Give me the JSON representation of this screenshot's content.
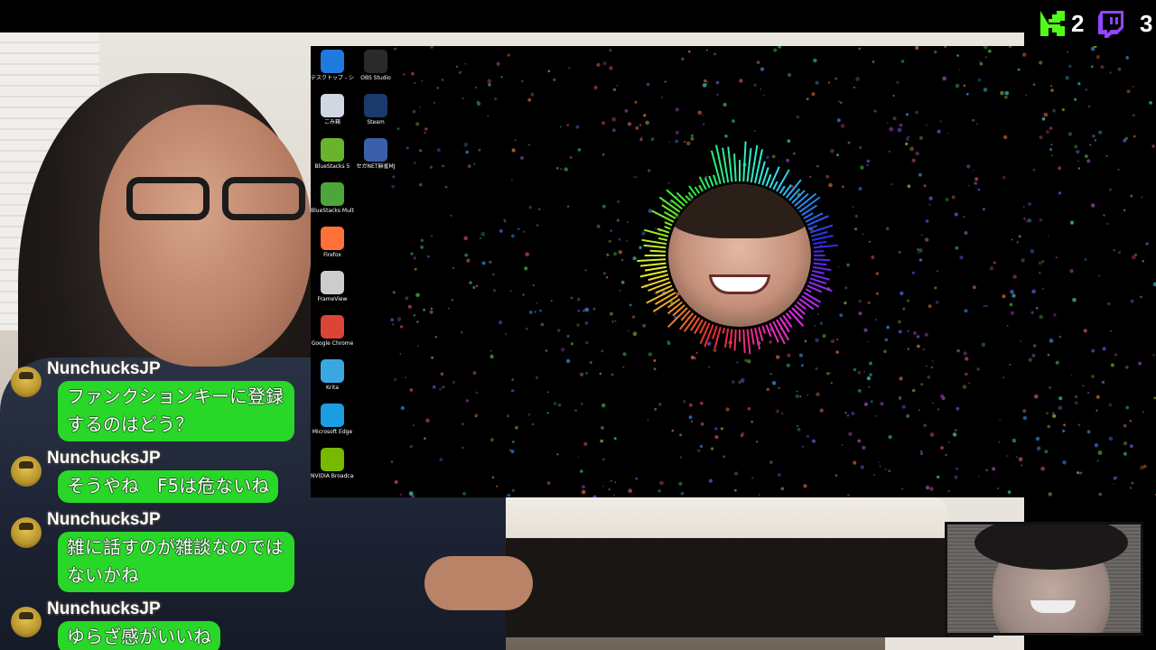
{
  "stream_counters": {
    "kick": {
      "icon": "kick-logo-icon",
      "color": "#53fc18",
      "count": "2"
    },
    "twitch": {
      "icon": "twitch-logo-icon",
      "color": "#9146ff",
      "count": "3"
    }
  },
  "desktop_icons": [
    {
      "label": "デスクトップ - ショートカット (OneDri...",
      "icon": "onedrive-icon",
      "color": "#1f7ae0"
    },
    {
      "label": "OBS Studio",
      "icon": "obs-icon",
      "color": "#2a2a2a"
    },
    {
      "label": "ごみ箱",
      "icon": "recycle-bin-icon",
      "color": "#cfd8e3"
    },
    {
      "label": "Steam",
      "icon": "steam-icon",
      "color": "#1b3a6b"
    },
    {
      "label": "BlueStacks 5",
      "icon": "bluestacks-icon",
      "color": "#6ab42d"
    },
    {
      "label": "セガNET麻雀MJ",
      "icon": "mahjong-icon",
      "color": "#3b5fa8"
    },
    {
      "label": "BlueStacks Multi-Instan...",
      "icon": "bluestacks-multi-icon",
      "color": "#4ca63a"
    },
    {
      "label": "Firefox",
      "icon": "firefox-icon",
      "color": "#ff7139"
    },
    {
      "label": "FrameView",
      "icon": "frameview-icon",
      "color": "#cccccc"
    },
    {
      "label": "Google Chrome",
      "icon": "chrome-icon",
      "color": "#db4437"
    },
    {
      "label": "Krita",
      "icon": "krita-icon",
      "color": "#3aa8e0"
    },
    {
      "label": "Microsoft Edge",
      "icon": "edge-icon",
      "color": "#1b9de2"
    },
    {
      "label": "NVIDIA Broadcast",
      "icon": "nvidia-broadcast-icon",
      "color": "#76b900"
    }
  ],
  "chat": {
    "accent": "#28d728",
    "messages": [
      {
        "user": "NunchucksJP",
        "text": "ファンクションキーに登録するのはどう？"
      },
      {
        "user": "NunchucksJP",
        "text": "そうやね　F5は危ないね"
      },
      {
        "user": "NunchucksJP",
        "text": "雑に話すのが雑談なのではないかね"
      },
      {
        "user": "NunchucksJP",
        "text": "ゆらざ感がいいね"
      }
    ]
  }
}
